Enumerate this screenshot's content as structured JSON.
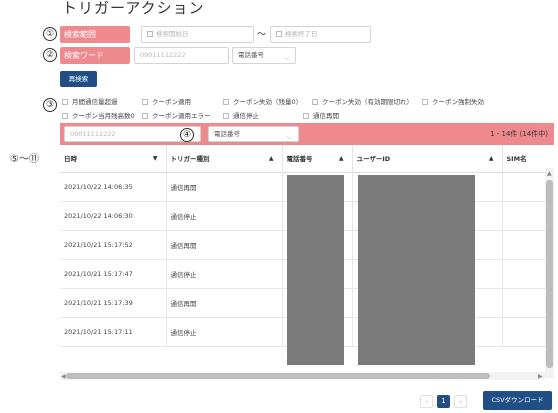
{
  "page": {
    "title": "トリガーアクション"
  },
  "markers": {
    "m1": "①",
    "m2": "②",
    "m3": "③",
    "m4": "④",
    "m5_11": "⑤〜⑪"
  },
  "search_range": {
    "label": "検索範囲",
    "start_placeholder": "検索開始日",
    "tilde": "〜",
    "end_placeholder": "検索終了日"
  },
  "search_word": {
    "label": "検索ワード",
    "input_value": "09011112222",
    "select_value": "電話番号"
  },
  "research_button": "再検索",
  "checkboxes": [
    {
      "label": "月間通信量超過",
      "checked": false
    },
    {
      "label": "クーポン適用",
      "checked": false
    },
    {
      "label": "クーポン失効（残量0）",
      "checked": false
    },
    {
      "label": "クーポン失効（有効期限切れ）",
      "checked": false
    },
    {
      "label": "クーポン強制失効",
      "checked": false
    },
    {
      "label": "クーポン当月残高数0",
      "checked": false
    },
    {
      "label": "クーポン適用エラー",
      "checked": false
    },
    {
      "label": "通信停止",
      "checked": false
    },
    {
      "label": "通信再開",
      "checked": false
    }
  ],
  "filter_bar": {
    "input_value": "09011112222",
    "select_value": "電話番号",
    "count_text": "1 - 14件 (14件中)"
  },
  "table": {
    "columns": [
      "日時",
      "トリガー種別",
      "電話番号",
      "ユーザーID",
      "SIM名"
    ],
    "rows": [
      [
        "2021/10/22 14:06:35",
        "通信再開"
      ],
      [
        "2021/10/22 14:06:30",
        "通信停止"
      ],
      [
        "2021/10/21 15:17:52",
        "通信再開"
      ],
      [
        "2021/10/21 15:17:47",
        "通信停止"
      ],
      [
        "2021/10/21 15:17:39",
        "通信再開"
      ],
      [
        "2021/10/21 15:17:11",
        "通信停止"
      ]
    ]
  },
  "pagination": {
    "prev": "‹",
    "current": "1",
    "next": "›"
  },
  "csv_button": "CSVダウンロード",
  "colors": {
    "accent_pink": "#ee8a8e",
    "button_navy": "#1f4f84",
    "mask_gray": "#7b7b7b"
  }
}
